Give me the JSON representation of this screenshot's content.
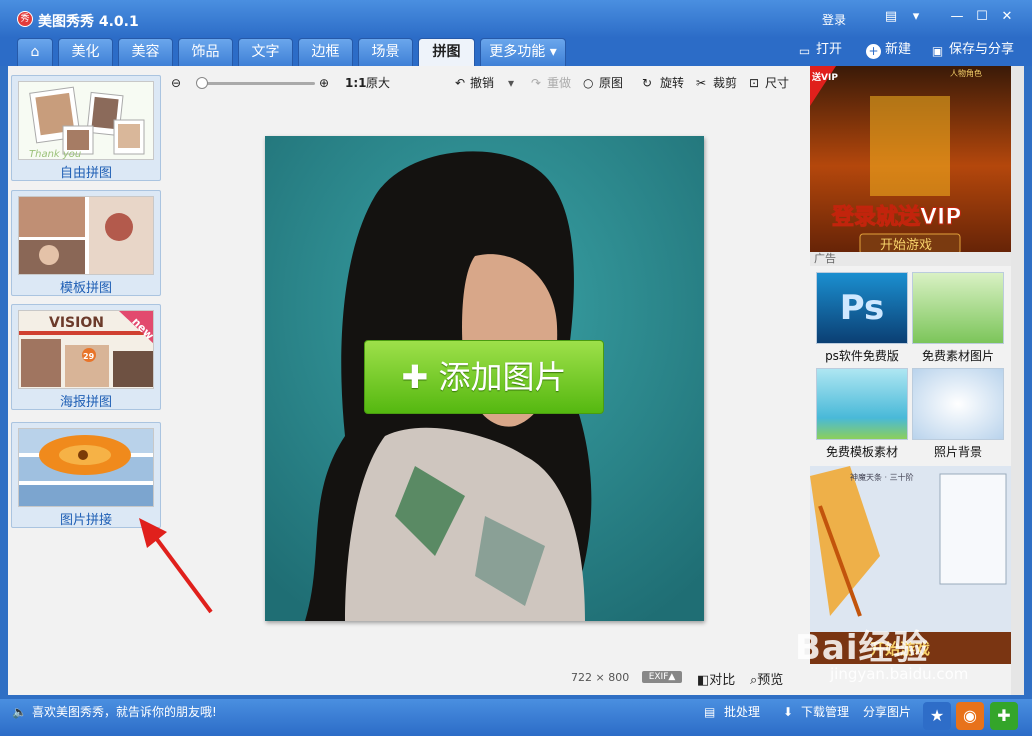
{
  "window": {
    "title": "美图秀秀 4.0.1",
    "logo": "秀",
    "login": "登录"
  },
  "tabs": [
    {
      "label": "美化"
    },
    {
      "label": "美容"
    },
    {
      "label": "饰品"
    },
    {
      "label": "文字"
    },
    {
      "label": "边框"
    },
    {
      "label": "场景"
    },
    {
      "label": "拼图"
    },
    {
      "label": "更多功能"
    }
  ],
  "actions": {
    "open": "打开",
    "new": "新建",
    "save_share": "保存与分享"
  },
  "sidebar": {
    "items": [
      {
        "label": "自由拼图",
        "thumb_text": "Thank you"
      },
      {
        "label": "模板拼图"
      },
      {
        "label": "海报拼图",
        "badge": "new",
        "thumb_text": "VISION",
        "num": "29"
      },
      {
        "label": "图片拼接"
      }
    ]
  },
  "toolbar": {
    "actual_size_icon": "1:1",
    "actual_size": "原大",
    "undo": "撤销",
    "redo": "重做",
    "original": "原图",
    "rotate": "旋转",
    "crop": "裁剪",
    "size": "尺寸"
  },
  "canvas": {
    "add_button": "添加图片",
    "dimensions_w": "722",
    "dimensions_x": "×",
    "dimensions_h": "800",
    "exif": "EXIF▲",
    "compare": "对比",
    "preview": "预览"
  },
  "ads": {
    "banner_text": "登录就送VIP",
    "banner_sub": "开始游戏",
    "banner_corner": "送VIP",
    "banner_top": "人物角色",
    "ad_label": "广告",
    "game_btn": "开始游戏",
    "game_title": "神魔天条 · 三十阶"
  },
  "resources": [
    {
      "label": "ps软件免费版"
    },
    {
      "label": "免费素材图片"
    },
    {
      "label": "免费模板素材"
    },
    {
      "label": "照片背景"
    }
  ],
  "statusbar": {
    "message": "喜欢美图秀秀，就告诉你的朋友哦!",
    "batch": "批处理",
    "download_manager": "下载管理",
    "share_image": "分享图片"
  },
  "watermark": {
    "brand": "Bai经验",
    "url": "jingyan.baidu.com"
  },
  "colors": {
    "accent": "#2c6cc7",
    "add_button": "#6cc820",
    "link": "#1f5fb5"
  }
}
